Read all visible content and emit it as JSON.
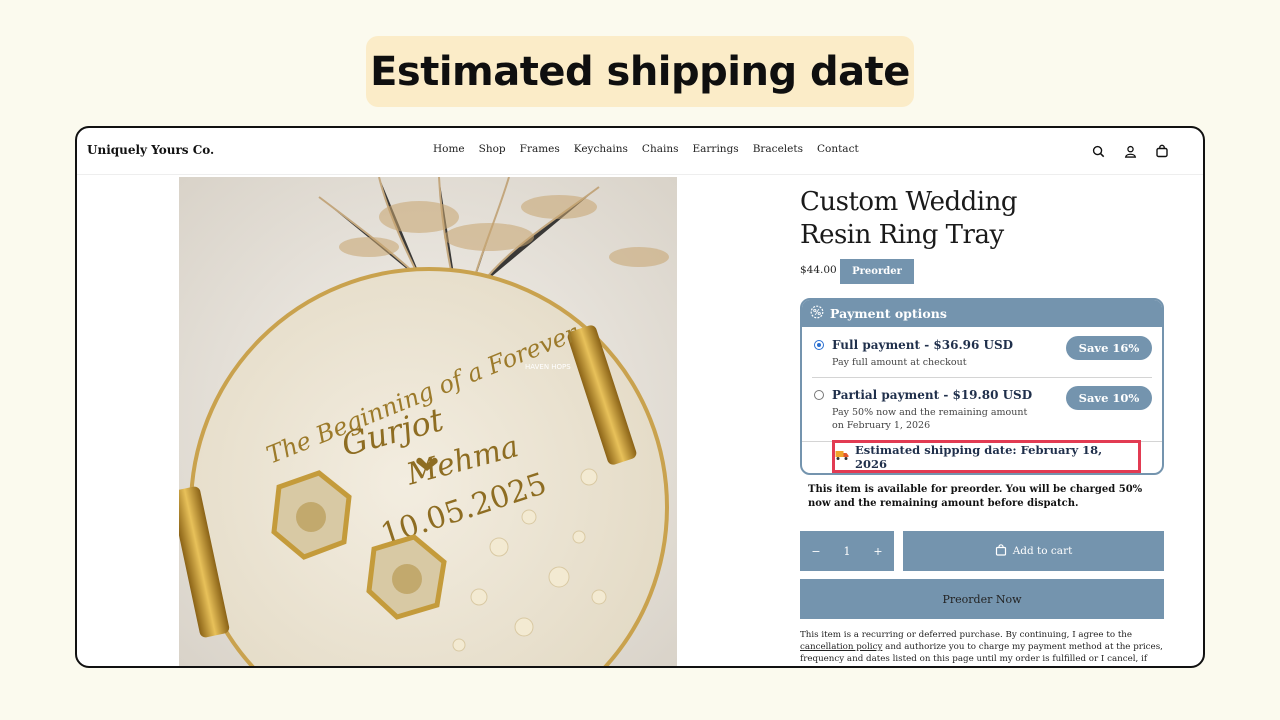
{
  "banner": {
    "title": "Estimated shipping date"
  },
  "header": {
    "brand": "Uniquely Yours Co.",
    "nav": [
      "Home",
      "Shop",
      "Frames",
      "Keychains",
      "Chains",
      "Earrings",
      "Bracelets",
      "Contact"
    ],
    "icons": [
      "search-icon",
      "account-icon",
      "cart-icon"
    ]
  },
  "product": {
    "title_line1": "Custom Wedding",
    "title_line2": "Resin Ring Tray",
    "price": "$44.00",
    "badge": "Preorder",
    "image_text": {
      "line1": "The Beginning of a Forever",
      "name1": "Gurjot",
      "name2": "Mehma",
      "date": "10.05.2025",
      "watermark": "HAVEN HOPS"
    }
  },
  "payment": {
    "heading": "Payment options",
    "options": [
      {
        "title": "Full payment - $36.96 USD",
        "sub": "Pay full amount at checkout",
        "save": "Save 16%",
        "selected": true
      },
      {
        "title": "Partial payment - $19.80 USD",
        "sub": "Pay 50% now and the remaining amount on February 1, 2026",
        "save": "Save 10%",
        "selected": false
      }
    ],
    "shipping": "Estimated shipping date: February 18, 2026"
  },
  "notice": "This item is available for preorder. You will be charged 50% now and the remaining amount before dispatch.",
  "cart": {
    "minus": "−",
    "qty": "1",
    "plus": "+",
    "add_label": "Add to cart",
    "preorder_label": "Preorder Now"
  },
  "legal": {
    "part1": "This item is a recurring or deferred purchase. By continuing, I agree to the ",
    "link": "cancellation policy",
    "part2": " and authorize you to charge my payment method at the prices, frequency and dates listed on this page until my order is fulfilled or I cancel, if permitted."
  },
  "colors": {
    "accent": "#7494ae",
    "highlight": "#e23b52",
    "banner_bg": "#fbecc8",
    "page_bg": "#fbfaee"
  }
}
